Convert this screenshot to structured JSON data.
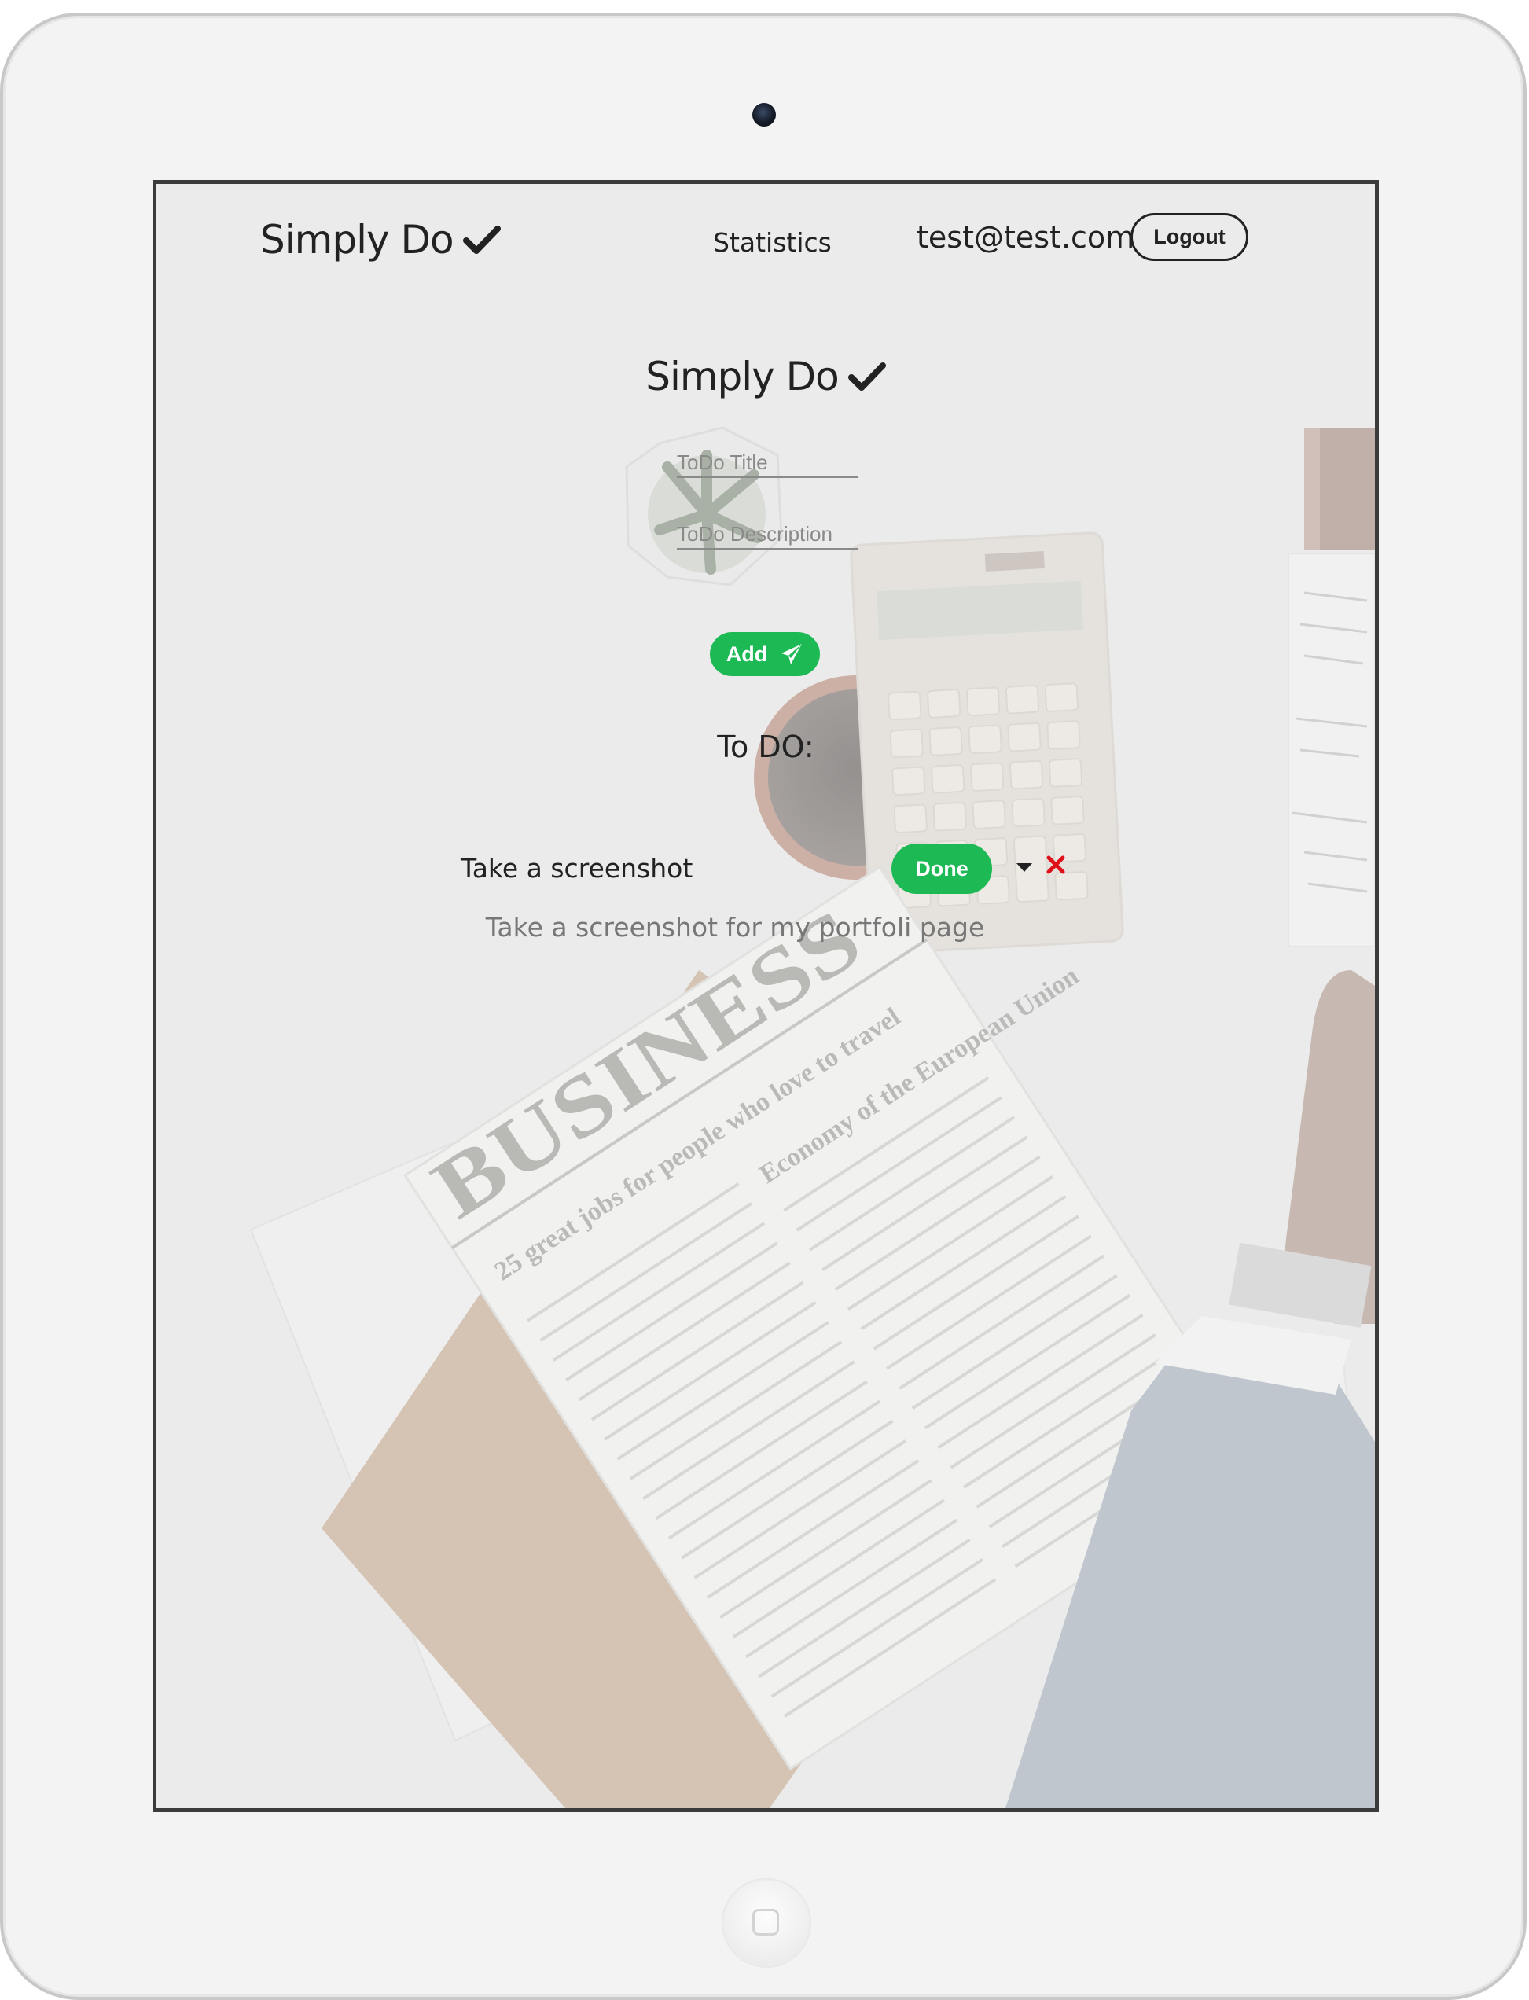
{
  "app": {
    "brand": "Simply Do",
    "title": "Simply Do"
  },
  "nav": {
    "statistics": "Statistics",
    "user_email": "test@test.com",
    "logout": "Logout"
  },
  "form": {
    "title_placeholder": "ToDo Title",
    "description_placeholder": "ToDo Description",
    "add_label": "Add"
  },
  "list": {
    "heading": "To DO:",
    "items": [
      {
        "title": "Take a screenshot",
        "description": "Take a screenshot for my portfoli page",
        "done_label": "Done"
      }
    ]
  },
  "background_texts": {
    "newspaper_masthead": "BUSINESS",
    "headline_1": "Economy of the European Union",
    "headline_2": "25 great jobs for people who love to travel"
  },
  "colors": {
    "accent_green": "#1db954",
    "delete_red": "#e0101a",
    "text_dark": "#222222",
    "text_muted": "#777777"
  },
  "icons": {
    "brand": "check-icon",
    "add": "paper-plane-icon",
    "expand": "caret-down-icon",
    "delete": "close-icon"
  }
}
